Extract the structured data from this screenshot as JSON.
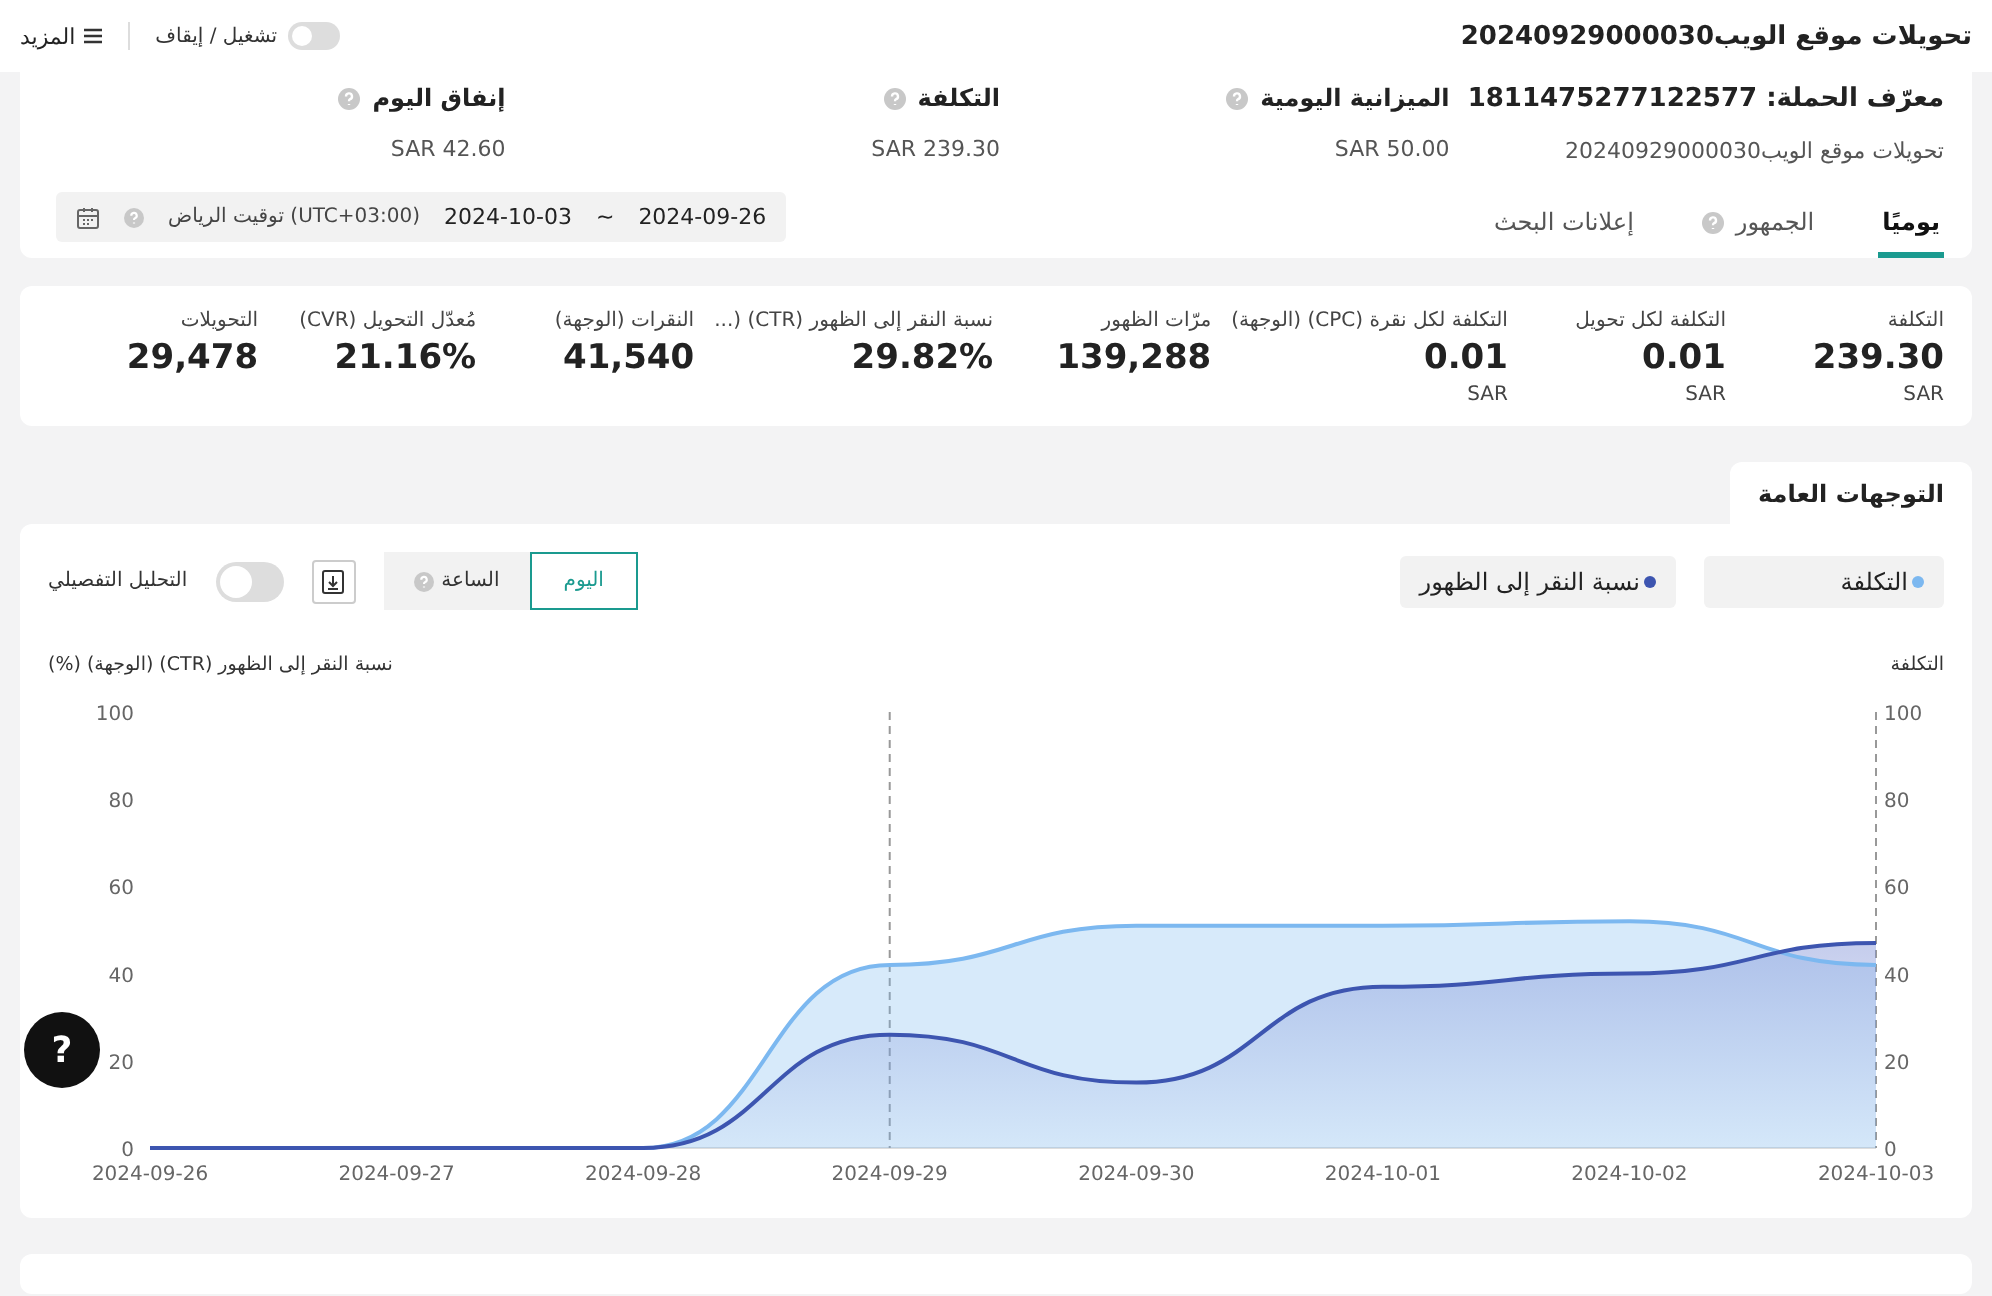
{
  "header": {
    "title": "تحويلات موقع الويب20240929000030",
    "toggle": {
      "label": "تشغيل / إيقاف",
      "on": false
    },
    "more": "المزيد"
  },
  "campaign": {
    "id_label": "معرّف الحملة: 1811475277122577",
    "subtitle": "تحويلات موقع الويب20240929000030",
    "stats": [
      {
        "label": "الميزانية اليومية",
        "value": "SAR 50.00",
        "help": true
      },
      {
        "label": "التكلفة",
        "value": "SAR 239.30",
        "help": true
      },
      {
        "label": "إنفاق اليوم",
        "value": "SAR 42.60",
        "help": true
      }
    ]
  },
  "tabs": [
    {
      "label": "يوميًا",
      "selected": true,
      "help": false
    },
    {
      "label": "الجمهور",
      "selected": false,
      "help": true
    },
    {
      "label": "إعلانات البحث",
      "selected": false,
      "help": false
    }
  ],
  "date_range": {
    "start": "2024-09-26",
    "separator": "~",
    "end": "2024-10-03",
    "timezone": "(UTC+03:00) توقيت الرياض"
  },
  "metrics": [
    {
      "label": "التكلفة",
      "value": "239.30",
      "unit": "SAR"
    },
    {
      "label": "التكلفة لكل تحويل",
      "value": "0.01",
      "unit": "SAR"
    },
    {
      "label": "التكلفة لكل نقرة (CPC) (الوجهة)",
      "value": "0.01",
      "unit": "SAR"
    },
    {
      "label": "مرّات الظهور",
      "value": "139,288"
    },
    {
      "label": "نسبة النقر إلى الظهور (CTR) (...",
      "value": "29.82%"
    },
    {
      "label": "النقرات (الوجهة)",
      "value": "41,540"
    },
    {
      "label": "مُعدّل التحويل (CVR)",
      "value": "21.16%"
    },
    {
      "label": "التحويلات",
      "value": "29,478"
    }
  ],
  "trends": {
    "title": "التوجهات العامة",
    "granularity": [
      {
        "label": "اليوم",
        "selected": true,
        "help": false
      },
      {
        "label": "الساعة",
        "selected": false,
        "help": true
      }
    ],
    "detail_toggle": {
      "label": "التحليل التفصيلي",
      "on": false
    },
    "right_axis": {
      "title": "التكلفة",
      "ticks": [
        "100",
        "80",
        "60",
        "40",
        "20",
        "0"
      ]
    },
    "chart_data": {
      "type": "area",
      "ylabel": "نسبة النقر إلى الظهور (CTR) (الوجهة) (%)",
      "x": [
        "2024-09-26",
        "2024-09-27",
        "2024-09-28",
        "2024-09-29",
        "2024-09-30",
        "2024-10-01",
        "2024-10-02",
        "2024-10-03"
      ],
      "ylim": [
        0,
        100
      ],
      "yticks": [
        0,
        20,
        40,
        60,
        80,
        100
      ],
      "series": [
        {
          "name": "التكلفة",
          "color": "#7cb8f0",
          "values": [
            0,
            0,
            0,
            42,
            51,
            51,
            52,
            42
          ]
        },
        {
          "name": "نسبة النقر إلى الظهور",
          "color": "#3d55b0",
          "values": [
            0,
            0,
            0,
            26,
            15,
            37,
            40,
            47
          ]
        }
      ]
    }
  },
  "help_button": "?"
}
